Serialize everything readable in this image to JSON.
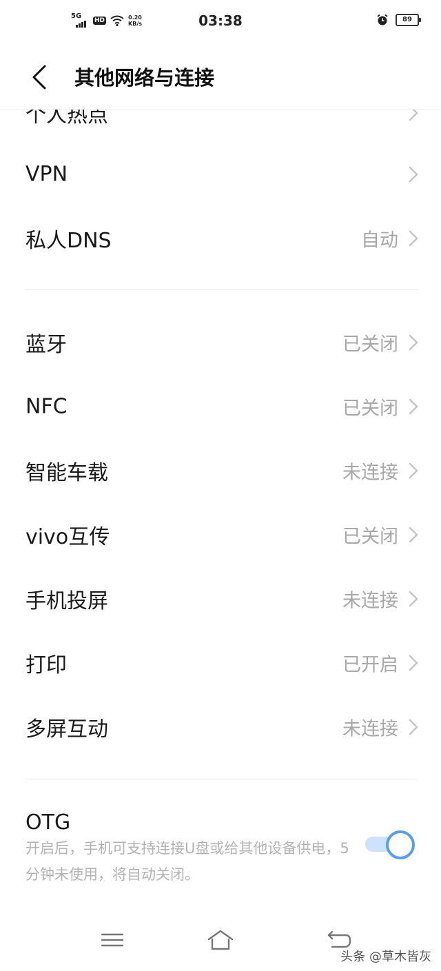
{
  "status_bar": {
    "network": "5G",
    "hd": "HD",
    "speed_value": "0.20",
    "speed_unit": "KB/s",
    "time": "03:38",
    "battery": "89"
  },
  "header": {
    "title": "其他网络与连接"
  },
  "rows": [
    {
      "label": "个人热点",
      "value": ""
    },
    {
      "label": "VPN",
      "value": ""
    },
    {
      "label": "私人DNS",
      "value": "自动"
    },
    {
      "label": "蓝牙",
      "value": "已关闭"
    },
    {
      "label": "NFC",
      "value": "已关闭"
    },
    {
      "label": "智能车载",
      "value": "未连接"
    },
    {
      "label": "vivo互传",
      "value": "已关闭"
    },
    {
      "label": "手机投屏",
      "value": "未连接"
    },
    {
      "label": "打印",
      "value": "已开启"
    },
    {
      "label": "多屏互动",
      "value": "未连接"
    }
  ],
  "otg": {
    "title": "OTG",
    "description": "开启后，手机可支持连接U盘或给其他设备供电，5分钟未使用，将自动关闭。",
    "enabled": true
  },
  "watermark": "头条 @草木皆灰",
  "colors": {
    "accent": "#5a9cf0",
    "secondary_text": "#a8a8a8"
  }
}
